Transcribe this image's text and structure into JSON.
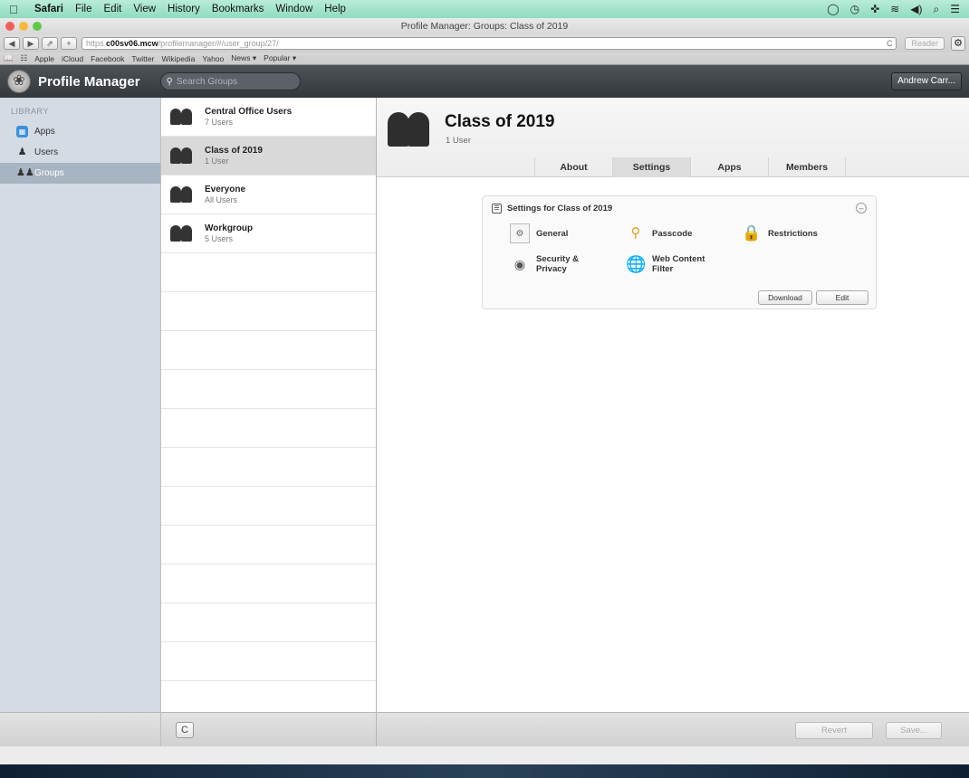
{
  "menubar": {
    "items": [
      "Safari",
      "File",
      "Edit",
      "View",
      "History",
      "Bookmarks",
      "Window",
      "Help"
    ],
    "status_icons": [
      "◯",
      "◷",
      "✜",
      "≋",
      "◀︎)",
      "⌕",
      "☰"
    ]
  },
  "window": {
    "title": "Profile Manager: Groups: Class of 2019"
  },
  "toolbar": {
    "back": "◀",
    "forward": "▶",
    "share": "⇗",
    "add": "+",
    "url_scheme": "https",
    "url_host": "c00sv06.mcw",
    "url_path": "/profilemanager/#/user_group/27/",
    "reload": "C",
    "reader_label": "Reader",
    "gear": "⚙"
  },
  "bookmarks": [
    "Apple",
    "iCloud",
    "Facebook",
    "Twitter",
    "Wikipedia",
    "Yahoo",
    "News ▾",
    "Popular ▾"
  ],
  "app": {
    "title": "Profile Manager",
    "search_placeholder": "Search Groups",
    "user_button": "Andrew Carr..."
  },
  "sidebar": {
    "section_label": "LIBRARY",
    "items": [
      {
        "label": "Apps",
        "icon": "apps-icon",
        "selected": false
      },
      {
        "label": "Users",
        "icon": "user-icon",
        "selected": false
      },
      {
        "label": "Groups",
        "icon": "groups-icon",
        "selected": true
      }
    ]
  },
  "groups": [
    {
      "name": "Central Office Users",
      "count": "7 Users",
      "selected": false
    },
    {
      "name": "Class of 2019",
      "count": "1 User",
      "selected": true
    },
    {
      "name": "Everyone",
      "count": "All Users",
      "selected": false
    },
    {
      "name": "Workgroup",
      "count": "5 Users",
      "selected": false
    }
  ],
  "detail": {
    "title": "Class of 2019",
    "subtitle": "1 User",
    "tabs": [
      "About",
      "Settings",
      "Apps",
      "Members"
    ],
    "selected_tab": "Settings",
    "settings": {
      "heading": "Settings for Class of 2019",
      "payloads": [
        {
          "label": "General",
          "icon": "general-icon"
        },
        {
          "label": "Passcode",
          "icon": "key-icon"
        },
        {
          "label": "Restrictions",
          "icon": "lock-icon"
        },
        {
          "label": "Security & Privacy",
          "label_line1": "Security &",
          "label_line2": "Privacy",
          "icon": "security-icon"
        },
        {
          "label": "Web Content Filter",
          "label_line1": "Web Content",
          "label_line2": "Filter",
          "icon": "globe-icon"
        }
      ],
      "download_label": "Download",
      "edit_label": "Edit"
    },
    "revert_label": "Revert",
    "save_label": "Save..."
  },
  "list_footer": {
    "refresh": "C"
  },
  "colors": {
    "menubar": "#a6e5cd",
    "app_header": "#3f4448",
    "sidebar": "#d4dbe3",
    "sidebar_selected": "#a7b4c2",
    "list_selected": "#d9d9d9"
  }
}
